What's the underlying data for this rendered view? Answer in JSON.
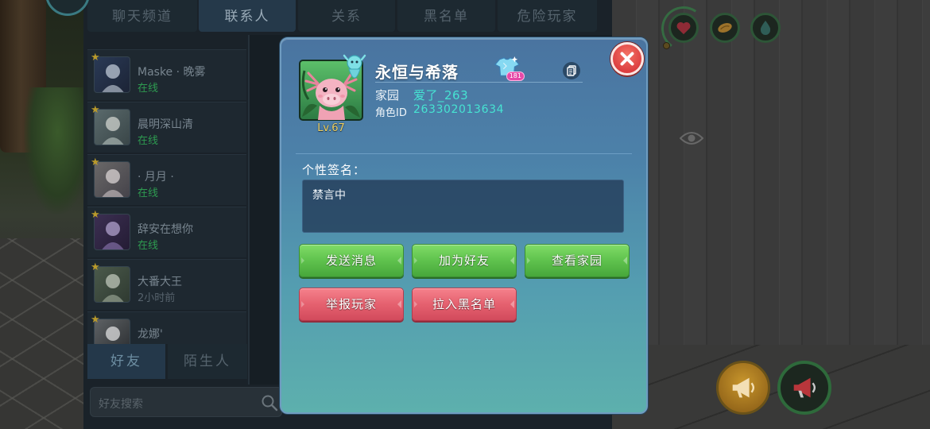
{
  "social_panel": {
    "tabs": [
      {
        "label": "聊天频道",
        "selected": false
      },
      {
        "label": "联系人",
        "selected": true
      },
      {
        "label": "关系",
        "selected": false
      },
      {
        "label": "黑名单",
        "selected": false
      },
      {
        "label": "危险玩家",
        "selected": false
      }
    ],
    "contacts": [
      {
        "name": "Maske · 晚雾",
        "status": "在线",
        "online": true,
        "starred": true
      },
      {
        "name": "晨明深山清",
        "status": "在线",
        "online": true,
        "starred": true
      },
      {
        "name": "· 月月 ·",
        "status": "在线",
        "online": true,
        "starred": true
      },
      {
        "name": "辞安在想你",
        "status": "在线",
        "online": true,
        "starred": true
      },
      {
        "name": "大番大王",
        "status": "2小时前",
        "online": false,
        "starred": true
      },
      {
        "name": "龙娜'",
        "starred": true
      }
    ],
    "list_tabs": [
      {
        "label": "好友",
        "selected": true
      },
      {
        "label": "陌生人",
        "selected": false
      }
    ],
    "search": {
      "placeholder": "好友搜索"
    }
  },
  "profile": {
    "name": "永恒与希落",
    "level": "Lv.67",
    "outfit_badge_count": "181",
    "home_label": "家园",
    "home_value": "爱了_263",
    "id_label": "角色ID",
    "id_value": "263302013634",
    "signature_label": "个性签名：",
    "signature_text": "禁言中",
    "actions": [
      {
        "label": "发送消息",
        "color": "#5fc24d"
      },
      {
        "label": "加为好友",
        "color": "#5fc24d"
      },
      {
        "label": "查看家园",
        "color": "#5fc24d"
      },
      {
        "label": "举报玩家",
        "color": "#e5616f"
      },
      {
        "label": "拉入黑名单",
        "color": "#e5616f"
      }
    ]
  },
  "hud": {
    "top_icons": [
      "heart-icon",
      "food-icon",
      "water-drop-icon"
    ],
    "view_toggle": "eye-icon",
    "broadcast_buttons": [
      "megaphone-icon",
      "megaphone-icon"
    ],
    "dialog_icons": [
      "close-icon",
      "copy-icon",
      "outfit-badge-icon",
      "search-icon"
    ]
  },
  "colors": {
    "modal-top": "#4a74a0",
    "modal-bottom": "#5db0ad",
    "accent-teal": "#46e3d2",
    "online-green": "#2e9a50",
    "close-red": "#dc3e40",
    "level-gold": "#efcf5c",
    "star-gold": "#b99a2b"
  }
}
